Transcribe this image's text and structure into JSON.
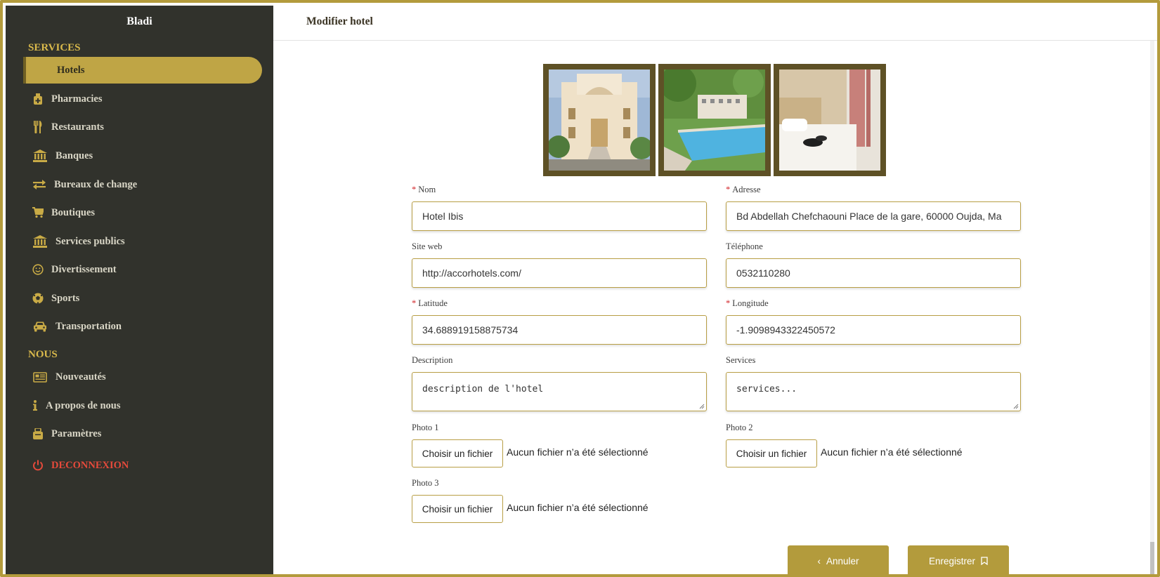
{
  "app": {
    "brand": "Bladi"
  },
  "sidebar": {
    "section_services": "SERVICES",
    "section_nous": "NOUS",
    "items": [
      {
        "label": "Hotels",
        "icon": "hotel-icon",
        "active": true
      },
      {
        "label": "Pharmacies",
        "icon": "pharmacy-icon"
      },
      {
        "label": "Restaurants",
        "icon": "utensils-icon"
      },
      {
        "label": "Banques",
        "icon": "bank-icon"
      },
      {
        "label": "Bureaux de change",
        "icon": "exchange-icon"
      },
      {
        "label": "Boutiques",
        "icon": "cart-icon"
      },
      {
        "label": "Services publics",
        "icon": "building-icon"
      },
      {
        "label": "Divertissement",
        "icon": "smile-icon"
      },
      {
        "label": "Sports",
        "icon": "soccer-ball-icon"
      },
      {
        "label": "Transportation",
        "icon": "car-icon"
      }
    ],
    "nous_items": [
      {
        "label": "Nouveautés",
        "icon": "newspaper-icon"
      },
      {
        "label": "A propos de nous",
        "icon": "info-icon"
      },
      {
        "label": "Paramètres",
        "icon": "settings-icon"
      }
    ],
    "logout": {
      "label": "DECONNEXION",
      "icon": "power-icon",
      "color": "#e64a3b"
    }
  },
  "header": {
    "title": "Modifier hotel"
  },
  "photos": [
    {
      "alt": "hotel-facade"
    },
    {
      "alt": "hotel-pool"
    },
    {
      "alt": "hotel-room"
    }
  ],
  "form": {
    "nom": {
      "label": "Nom",
      "required": true,
      "value": "Hotel Ibis"
    },
    "adresse": {
      "label": "Adresse",
      "required": true,
      "value": "Bd Abdellah Chefchaouni Place de la gare, 60000 Oujda, Ma"
    },
    "site_web": {
      "label": "Site web",
      "value": "http://accorhotels.com/"
    },
    "telephone": {
      "label": "Téléphone",
      "value": "0532110280"
    },
    "latitude": {
      "label": "Latitude",
      "required": true,
      "value": "34.688919158875734"
    },
    "longitude": {
      "label": "Longitude",
      "required": true,
      "value": "-1.9098943322450572"
    },
    "description": {
      "label": "Description",
      "value": "description de l'hotel"
    },
    "services": {
      "label": "Services",
      "value": "services..."
    },
    "photo1": {
      "label": "Photo 1",
      "button": "Choisir un fichier",
      "status": "Aucun fichier n’a été sélectionné"
    },
    "photo2": {
      "label": "Photo 2",
      "button": "Choisir un fichier",
      "status": "Aucun fichier n’a été sélectionné"
    },
    "photo3": {
      "label": "Photo 3",
      "button": "Choisir un fichier",
      "status": "Aucun fichier n’a été sélectionné"
    }
  },
  "actions": {
    "cancel": "Annuler",
    "save": "Enregistrer"
  },
  "colors": {
    "accent": "#b39b3c",
    "sidebar_bg": "#31322c",
    "required": "#d2262a"
  }
}
